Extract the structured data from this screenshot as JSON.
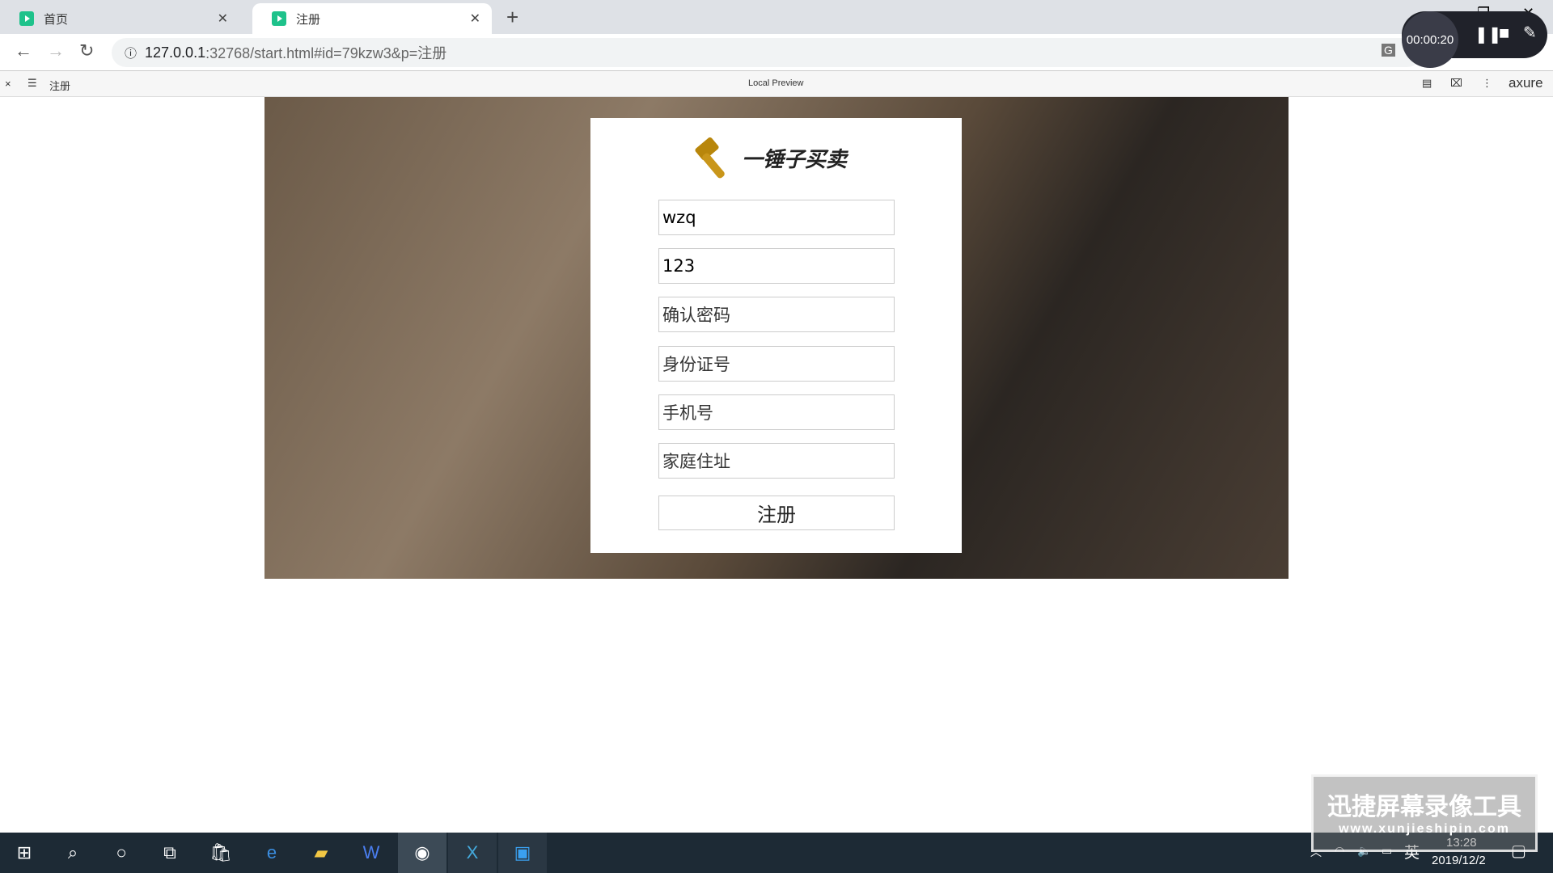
{
  "browser": {
    "tabs": [
      {
        "label": "首页"
      },
      {
        "label": "注册"
      }
    ],
    "url_host": "127.0.0.1",
    "url_rest": ":32768/start.html#id=79kzw3&p=注册"
  },
  "axure": {
    "page": "注册",
    "center": "Local Preview",
    "brand": "axure"
  },
  "recorder": {
    "time": "00:00:20"
  },
  "form": {
    "logo_text": "一锤子买卖",
    "username": "wzq",
    "password": "123",
    "confirm_placeholder": "确认密码",
    "id_placeholder": "身份证号",
    "phone_placeholder": "手机号",
    "address_placeholder": "家庭住址",
    "submit": "注册"
  },
  "taskbar": {
    "ime": "英",
    "time": "13:28",
    "date": "2019/12/2"
  },
  "watermark": {
    "title": "迅捷屏幕录像工具",
    "url": "www.xunjieshipin.com"
  }
}
